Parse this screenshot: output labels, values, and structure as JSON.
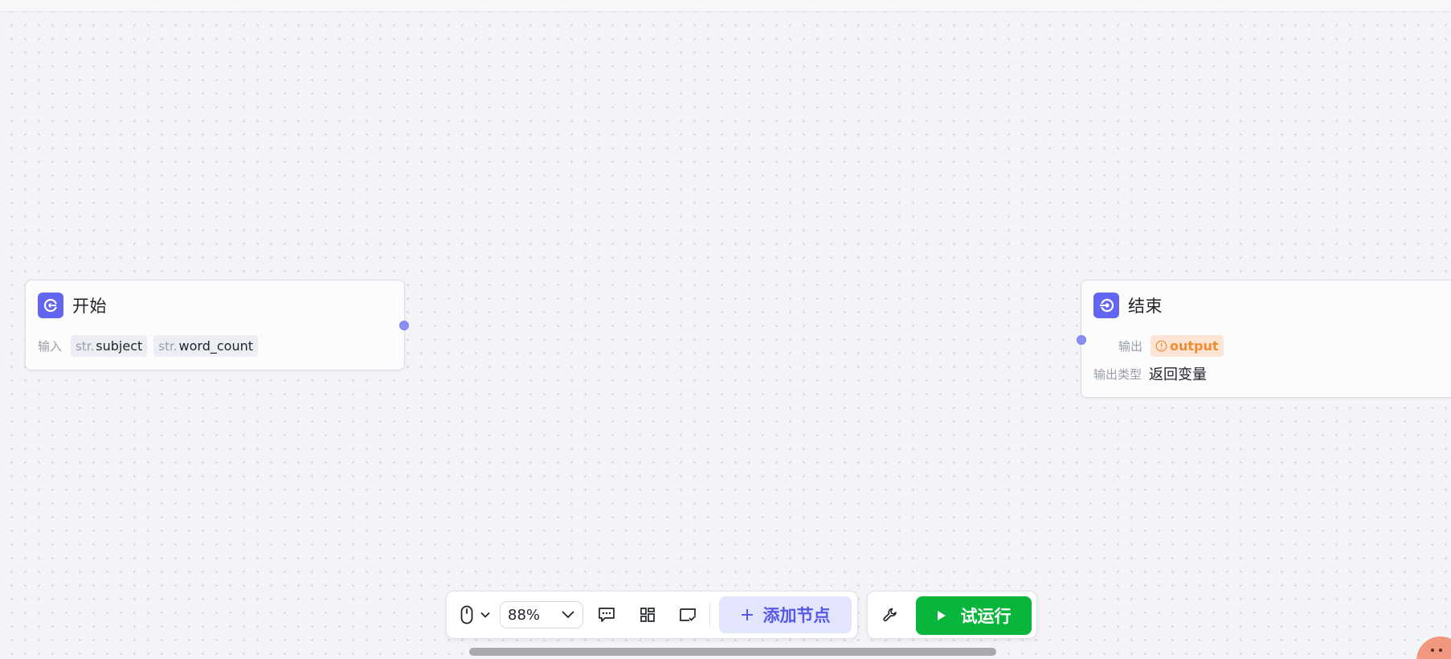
{
  "start_node": {
    "title": "开始",
    "input_label": "输入",
    "inputs": [
      {
        "type": "str.",
        "name": "subject"
      },
      {
        "type": "str.",
        "name": "word_count"
      }
    ]
  },
  "end_node": {
    "title": "结束",
    "output_label": "输出",
    "output_var": "output",
    "output_type_label": "输出类型",
    "output_type_value": "返回变量"
  },
  "toolbar": {
    "zoom": "88%",
    "add_node_label": "添加节点",
    "run_label": "试运行"
  },
  "colors": {
    "accent": "#6366f1",
    "run_green": "#07b63a",
    "warning": "#f28a2f"
  },
  "icons": [
    "start-node-icon",
    "end-node-icon",
    "mouse-icon",
    "chevron-down-icon",
    "comment-icon",
    "layout-icon",
    "minimap-icon",
    "plus-icon",
    "wrench-icon",
    "play-icon",
    "warning-icon"
  ]
}
